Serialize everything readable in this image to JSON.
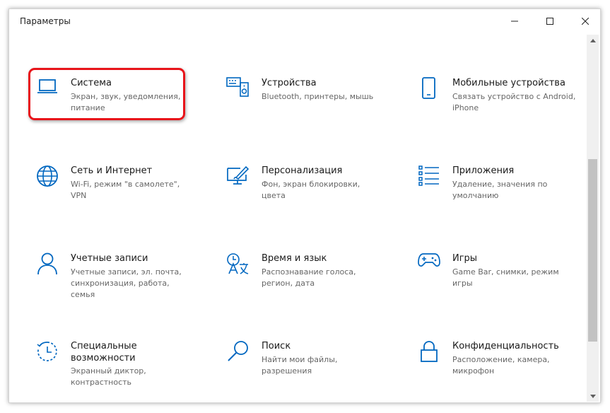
{
  "window": {
    "title": "Параметры"
  },
  "colors": {
    "accent": "#0067c0",
    "highlight": "#e8141a"
  },
  "tiles": [
    {
      "title": "Система",
      "desc_lines": [
        "Экран, звук, уведомления,",
        "питание"
      ],
      "icon": "laptop-icon"
    },
    {
      "title": "Устройства",
      "desc_lines": [
        "Bluetooth, принтеры, мышь"
      ],
      "icon": "devices-icon"
    },
    {
      "title": "Мобильные устройства",
      "desc_lines": [
        "Связать устройство с Android,",
        "iPhone"
      ],
      "icon": "phone-icon"
    },
    {
      "title": "Сеть и Интернет",
      "desc_lines": [
        "Wi-Fi, режим \"в самолете\",",
        "VPN"
      ],
      "icon": "globe-icon"
    },
    {
      "title": "Персонализация",
      "desc_lines": [
        "Фон, экран блокировки, цвета"
      ],
      "icon": "personalization-icon"
    },
    {
      "title": "Приложения",
      "desc_lines": [
        "Удаление, значения по",
        "умолчанию"
      ],
      "icon": "apps-list-icon"
    },
    {
      "title": "Учетные записи",
      "desc_lines": [
        "Учетные записи, эл. почта,",
        "синхронизация, работа, семья"
      ],
      "icon": "person-icon"
    },
    {
      "title": "Время и язык",
      "desc_lines": [
        "Распознавание голоса,",
        "регион, дата"
      ],
      "icon": "time-language-icon"
    },
    {
      "title": "Игры",
      "desc_lines": [
        "Game Bar, снимки, режим",
        "игры"
      ],
      "icon": "gamepad-icon"
    },
    {
      "title_lines": [
        "Специальные",
        "возможности"
      ],
      "desc_lines": [
        "Экранный диктор,",
        "контрастность"
      ],
      "icon": "accessibility-icon"
    },
    {
      "title": "Поиск",
      "desc_lines": [
        "Найти мои файлы,",
        "разрешения"
      ],
      "icon": "search-icon"
    },
    {
      "title": "Конфиденциальность",
      "desc_lines": [
        "Расположение, камера,",
        "микрофон"
      ],
      "icon": "lock-icon"
    }
  ]
}
